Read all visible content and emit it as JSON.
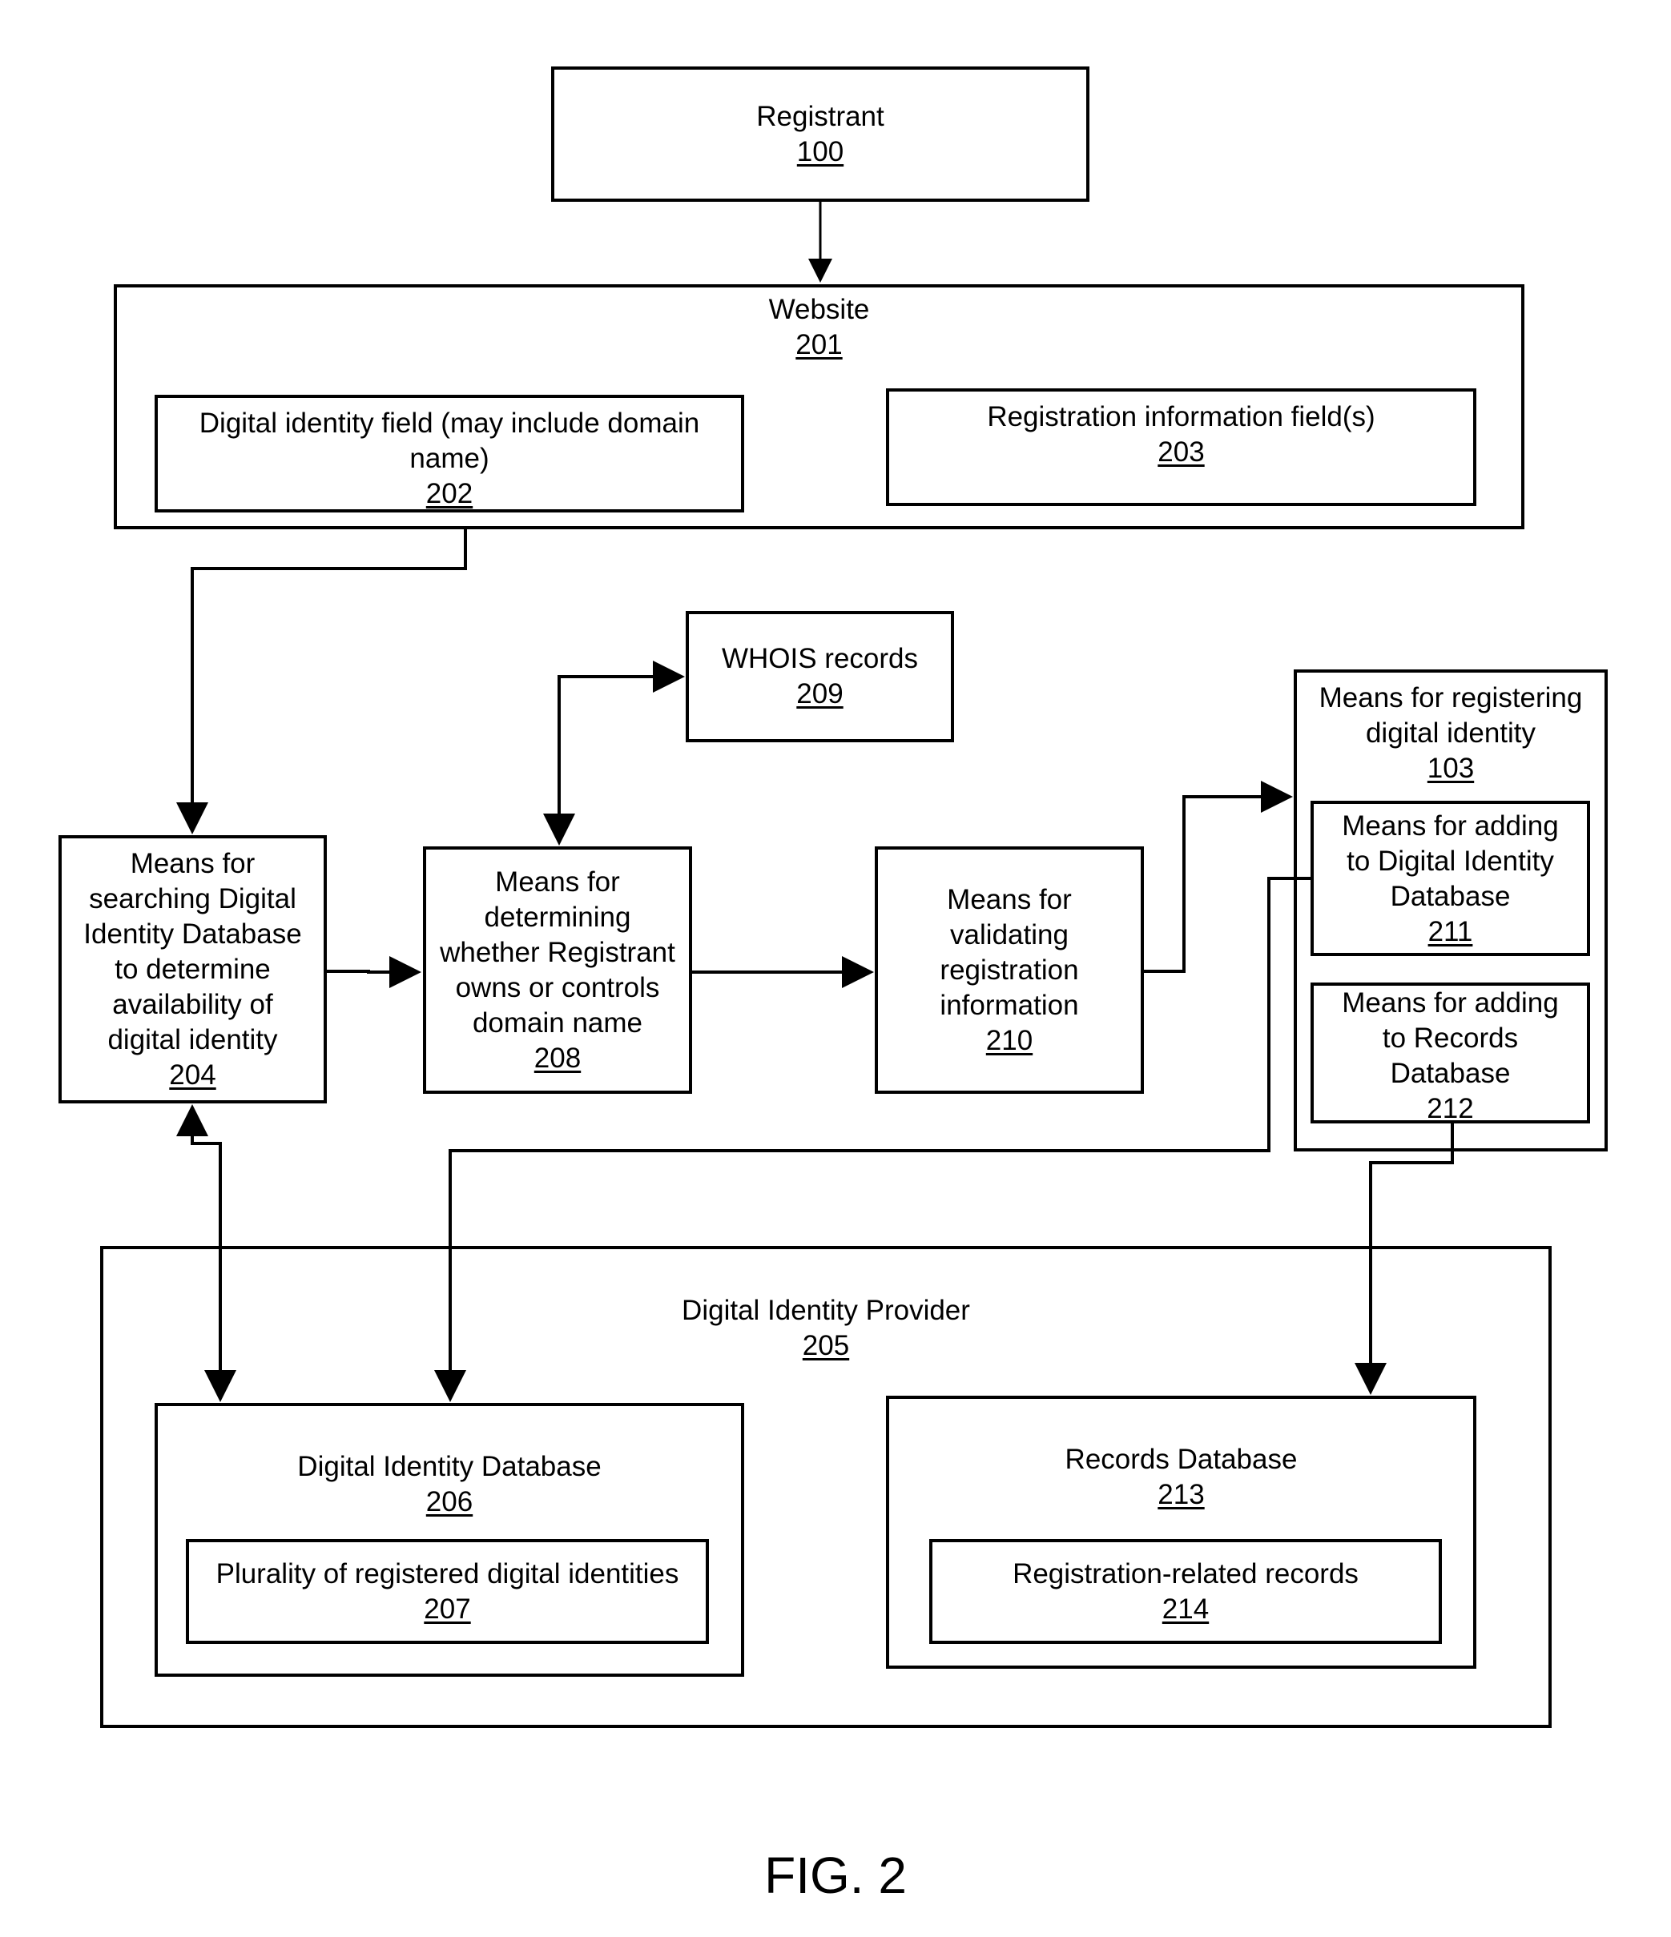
{
  "figure": {
    "caption": "FIG. 2",
    "nodes": {
      "registrant": {
        "label": "Registrant",
        "ref": "100"
      },
      "website": {
        "label": "Website",
        "ref": "201"
      },
      "digital_identity_field": {
        "label": "Digital identity field (may include domain\nname)",
        "ref": "202"
      },
      "registration_info_fields": {
        "label": "Registration information field(s)",
        "ref": "203"
      },
      "search_means": {
        "label": "Means for\nsearching Digital\nIdentity Database\nto determine\navailability of\ndigital identity",
        "ref": "204"
      },
      "determine_means": {
        "label": "Means for\ndetermining\nwhether Registrant\nowns or controls\ndomain name",
        "ref": "208"
      },
      "whois": {
        "label": "WHOIS records",
        "ref": "209"
      },
      "validate_means": {
        "label": "Means for\nvalidating\nregistration\ninformation",
        "ref": "210"
      },
      "register_means": {
        "label": "Means for registering\ndigital identity",
        "ref": "103"
      },
      "add_identity_db_means": {
        "label": "Means for adding\nto Digital Identity\nDatabase",
        "ref": "211"
      },
      "add_records_db_means": {
        "label": "Means for adding\nto Records\nDatabase",
        "ref": "212"
      },
      "provider": {
        "label": "Digital Identity Provider",
        "ref": "205"
      },
      "identity_db": {
        "label": "Digital Identity Database",
        "ref": "206"
      },
      "registered_identities": {
        "label": "Plurality of  registered digital identities",
        "ref": "207"
      },
      "records_db": {
        "label": "Records Database",
        "ref": "213"
      },
      "registration_records": {
        "label": "Registration-related records",
        "ref": "214"
      }
    },
    "edges": [
      {
        "from": "registrant",
        "to": "website",
        "direction": "one-way"
      },
      {
        "from": "digital_identity_field",
        "to": "search_means",
        "direction": "one-way"
      },
      {
        "from": "search_means",
        "to": "determine_means",
        "direction": "one-way"
      },
      {
        "from": "determine_means",
        "to": "whois",
        "direction": "two-way"
      },
      {
        "from": "determine_means",
        "to": "validate_means",
        "direction": "one-way"
      },
      {
        "from": "validate_means",
        "to": "register_means",
        "direction": "one-way"
      },
      {
        "from": "search_means",
        "to": "identity_db",
        "direction": "two-way"
      },
      {
        "from": "add_identity_db_means",
        "to": "identity_db",
        "direction": "one-way"
      },
      {
        "from": "add_records_db_means",
        "to": "records_db",
        "direction": "one-way"
      }
    ]
  }
}
